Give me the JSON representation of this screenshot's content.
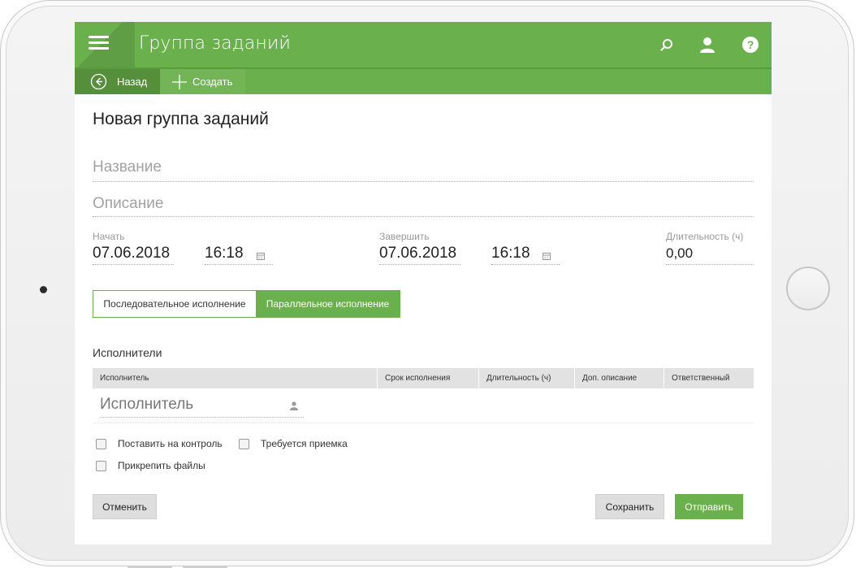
{
  "colors": {
    "accent": "#6ab04c",
    "accent_dark": "#558f3b",
    "header_text": "#ffffff"
  },
  "header": {
    "title": "Группа заданий",
    "icons": [
      "menu-icon",
      "search-icon",
      "user-icon",
      "help-icon"
    ]
  },
  "toolbar": {
    "back_label": "Назад",
    "create_label": "Создать"
  },
  "page_title": "Новая группа заданий",
  "form": {
    "name_placeholder": "Название",
    "description_placeholder": "Описание",
    "start": {
      "label": "Начать",
      "date": "07.06.2018",
      "time": "16:18"
    },
    "end": {
      "label": "Завершить",
      "date": "07.06.2018",
      "time": "16:18"
    },
    "duration": {
      "label": "Длительность (ч)",
      "value": "0,00"
    }
  },
  "mode": {
    "sequential": "Последовательное исполнение",
    "parallel": "Параллельное исполнение",
    "selected": "parallel"
  },
  "executors": {
    "title": "Исполнители",
    "columns": [
      "Исполнитель",
      "Срок исполнения",
      "Длительность (ч)",
      "Доп. описание",
      "Ответственный"
    ],
    "executor_placeholder": "Исполнитель"
  },
  "options": {
    "control": "Поставить на контроль",
    "acceptance": "Требуется приемка",
    "attach": "Прикрепить файлы"
  },
  "actions": {
    "cancel": "Отменить",
    "save": "Сохранить",
    "send": "Отправить"
  }
}
